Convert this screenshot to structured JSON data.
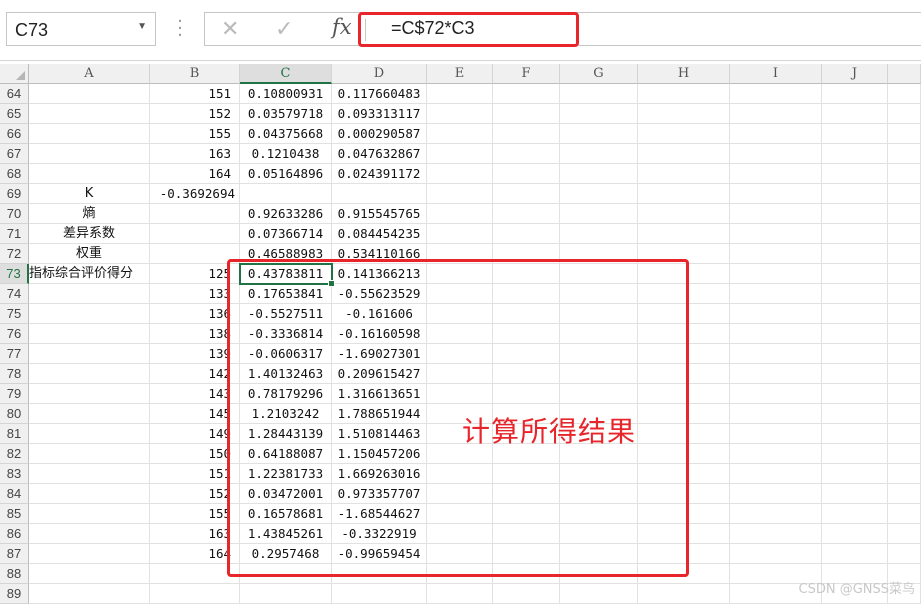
{
  "formula_bar": {
    "name_box": "C73",
    "fx": "fx",
    "formula": "=C$72*C3"
  },
  "columns": [
    "A",
    "B",
    "C",
    "D",
    "E",
    "F",
    "G",
    "H",
    "I",
    "J"
  ],
  "selected_cell": {
    "column": "C",
    "row": "73"
  },
  "rows": [
    {
      "n": "64",
      "a": "",
      "b": "151",
      "c": "0.10800931",
      "d": "0.117660483"
    },
    {
      "n": "65",
      "a": "",
      "b": "152",
      "c": "0.03579718",
      "d": "0.093313117"
    },
    {
      "n": "66",
      "a": "",
      "b": "155",
      "c": "0.04375668",
      "d": "0.000290587"
    },
    {
      "n": "67",
      "a": "",
      "b": "163",
      "c": "0.1210438",
      "d": "0.047632867"
    },
    {
      "n": "68",
      "a": "",
      "b": "164",
      "c": "0.05164896",
      "d": "0.024391172"
    },
    {
      "n": "69",
      "a": "K",
      "b": "-0.3692694",
      "c": "",
      "d": ""
    },
    {
      "n": "70",
      "a": "熵",
      "b": "",
      "c": "0.92633286",
      "d": "0.915545765"
    },
    {
      "n": "71",
      "a": "差异系数",
      "b": "",
      "c": "0.07366714",
      "d": "0.084454235"
    },
    {
      "n": "72",
      "a": "权重",
      "b": "",
      "c": "0.46588983",
      "d": "0.534110166"
    },
    {
      "n": "73",
      "a": "指标综合评价得分",
      "b": "125",
      "c": "0.43783811",
      "d": "0.141366213"
    },
    {
      "n": "74",
      "a": "",
      "b": "133",
      "c": "0.17653841",
      "d": "-0.55623529"
    },
    {
      "n": "75",
      "a": "",
      "b": "136",
      "c": "-0.5527511",
      "d": "-0.161606"
    },
    {
      "n": "76",
      "a": "",
      "b": "138",
      "c": "-0.3336814",
      "d": "-0.16160598"
    },
    {
      "n": "77",
      "a": "",
      "b": "139",
      "c": "-0.0606317",
      "d": "-1.69027301"
    },
    {
      "n": "78",
      "a": "",
      "b": "142",
      "c": "1.40132463",
      "d": "0.209615427"
    },
    {
      "n": "79",
      "a": "",
      "b": "143",
      "c": "0.78179296",
      "d": "1.316613651"
    },
    {
      "n": "80",
      "a": "",
      "b": "145",
      "c": "1.2103242",
      "d": "1.788651944"
    },
    {
      "n": "81",
      "a": "",
      "b": "149",
      "c": "1.28443139",
      "d": "1.510814463"
    },
    {
      "n": "82",
      "a": "",
      "b": "150",
      "c": "0.64188087",
      "d": "1.150457206"
    },
    {
      "n": "83",
      "a": "",
      "b": "151",
      "c": "1.22381733",
      "d": "1.669263016"
    },
    {
      "n": "84",
      "a": "",
      "b": "152",
      "c": "0.03472001",
      "d": "0.973357707"
    },
    {
      "n": "85",
      "a": "",
      "b": "155",
      "c": "0.16578681",
      "d": "-1.68544627"
    },
    {
      "n": "86",
      "a": "",
      "b": "163",
      "c": "1.43845261",
      "d": "-0.3322919"
    },
    {
      "n": "87",
      "a": "",
      "b": "164",
      "c": "0.2957468",
      "d": "-0.99659454"
    },
    {
      "n": "88",
      "a": "",
      "b": "",
      "c": "",
      "d": ""
    },
    {
      "n": "89",
      "a": "",
      "b": "",
      "c": "",
      "d": ""
    }
  ],
  "annotation": "计算所得结果",
  "watermark": "CSDN @GNSS菜鸟",
  "colors": {
    "highlight_red": "#e8252b",
    "excel_green": "#217346"
  }
}
